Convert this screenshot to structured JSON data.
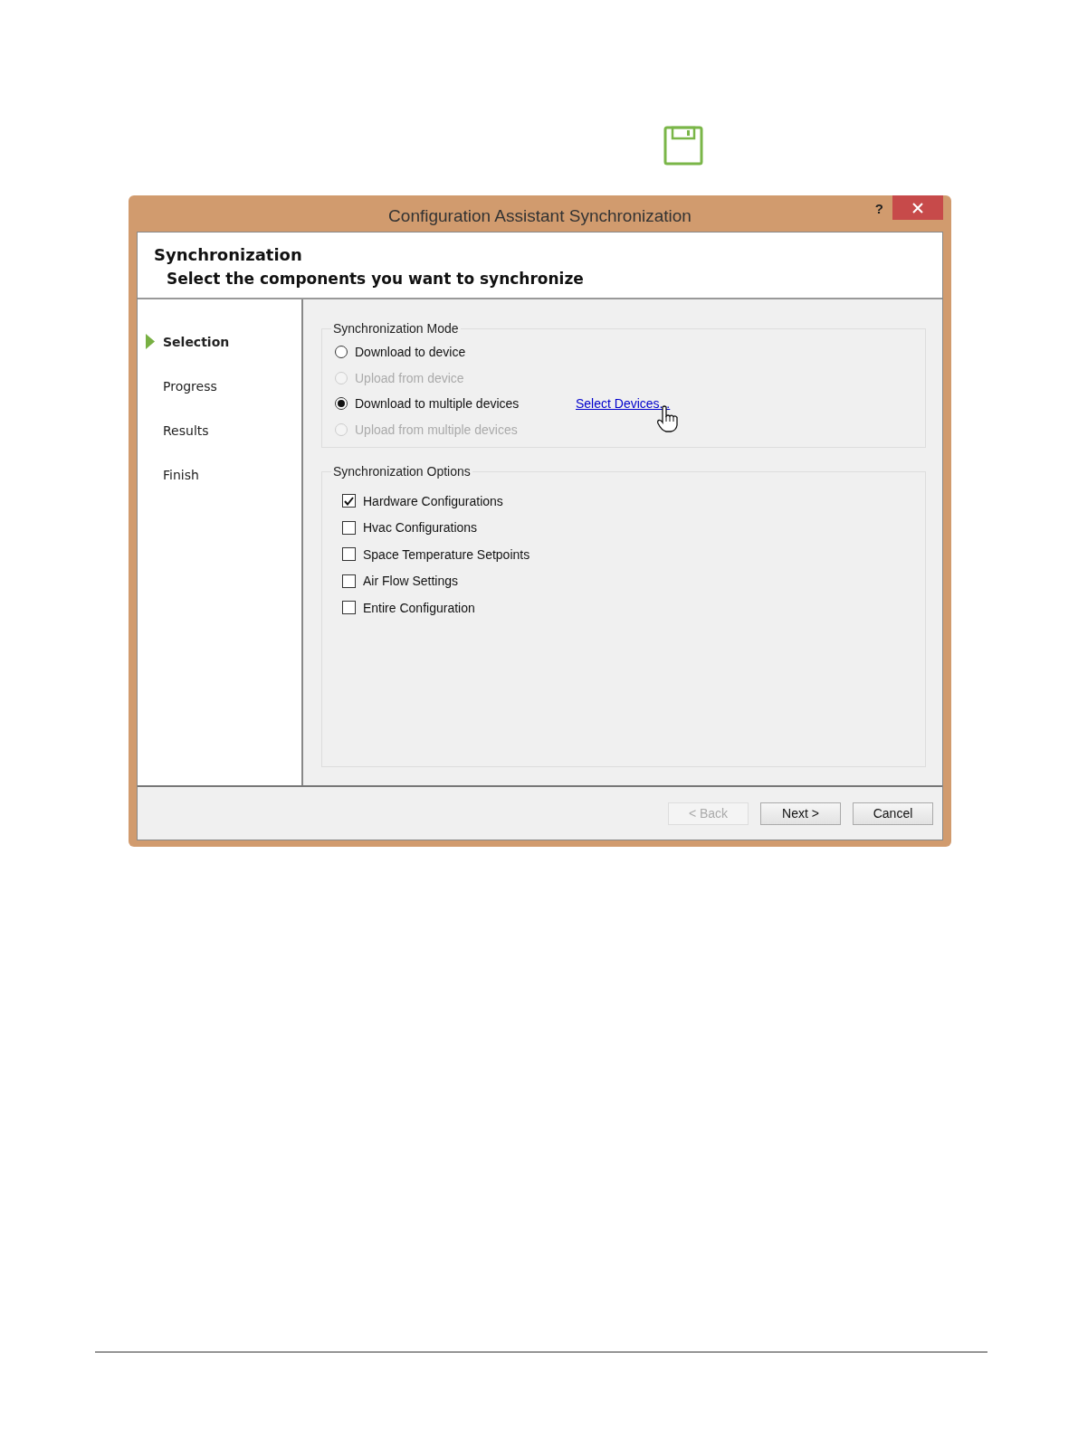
{
  "window": {
    "title": "Configuration Assistant Synchronization",
    "help": "?"
  },
  "header": {
    "title": "Synchronization",
    "subtitle": "Select the components you want to synchronize"
  },
  "steps": [
    {
      "label": "Selection",
      "selected": true
    },
    {
      "label": "Progress",
      "selected": false
    },
    {
      "label": "Results",
      "selected": false
    },
    {
      "label": "Finish",
      "selected": false
    }
  ],
  "sync_mode": {
    "title": "Synchronization Mode",
    "link": "Select Devices...",
    "options": [
      {
        "label": "Download to device",
        "selected": false,
        "disabled": false
      },
      {
        "label": "Upload from device",
        "selected": false,
        "disabled": true
      },
      {
        "label": "Download to multiple devices",
        "selected": true,
        "disabled": false
      },
      {
        "label": "Upload from multiple devices",
        "selected": false,
        "disabled": true
      }
    ]
  },
  "sync_options": {
    "title": "Synchronization Options",
    "items": [
      {
        "label": "Hardware Configurations",
        "checked": true
      },
      {
        "label": "Hvac Configurations",
        "checked": false
      },
      {
        "label": "Space Temperature Setpoints",
        "checked": false
      },
      {
        "label": "Air Flow Settings",
        "checked": false
      },
      {
        "label": "Entire Configuration",
        "checked": false
      }
    ]
  },
  "buttons": [
    {
      "label": "< Back",
      "disabled": true
    },
    {
      "label": "Next >",
      "disabled": false
    },
    {
      "label": "Cancel",
      "disabled": false
    }
  ]
}
